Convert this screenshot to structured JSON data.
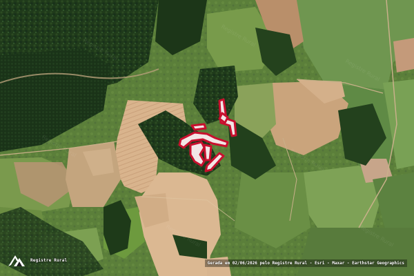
{
  "logo": {
    "text": "Registre Rural",
    "icon": "registre-rural-logo"
  },
  "attribution": "Gerada em 02/06/2026 pelo Registre Rural - Esri - Maxar - Earthstar Geographics",
  "highlight": {
    "stroke": "#c8102e",
    "fill": "#f2e6e6"
  },
  "watermark": "Registre Rural"
}
